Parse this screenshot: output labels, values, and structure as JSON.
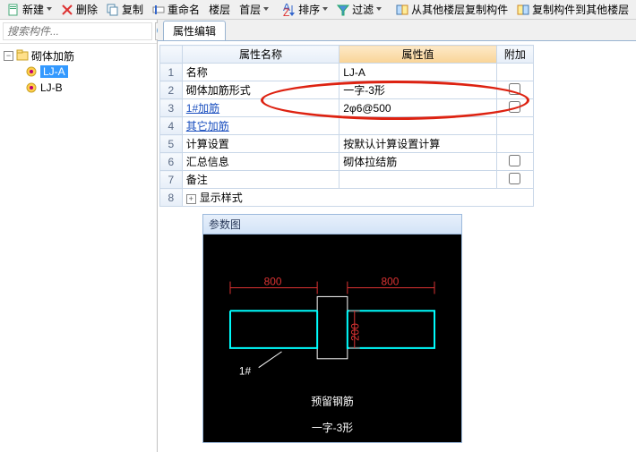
{
  "toolbar": {
    "new": "新建",
    "delete": "删除",
    "copy": "复制",
    "rename": "重命名",
    "layer": "楼层",
    "first": "首层",
    "sort": "排序",
    "filter": "过滤",
    "copy_from": "从其他楼层复制构件",
    "copy_to": "复制构件到其他楼层"
  },
  "search": {
    "placeholder": "搜索构件..."
  },
  "tree": {
    "root": "砌体加筋",
    "items": [
      "LJ-A",
      "LJ-B"
    ]
  },
  "tab": {
    "label": "属性编辑"
  },
  "table": {
    "headers": {
      "name": "属性名称",
      "value": "属性值",
      "extra": "附加"
    },
    "rows": [
      {
        "n": "1",
        "name": "名称",
        "value": "LJ-A",
        "chk": false
      },
      {
        "n": "2",
        "name": "砌体加筋形式",
        "value": "一字-3形",
        "chk": true
      },
      {
        "n": "3",
        "name": "1#加筋",
        "value": "2φ6@500",
        "link": true,
        "chk": true
      },
      {
        "n": "4",
        "name": "其它加筋",
        "value": "",
        "link": true,
        "chk": false
      },
      {
        "n": "5",
        "name": "计算设置",
        "value": "按默认计算设置计算",
        "chk": false
      },
      {
        "n": "6",
        "name": "汇总信息",
        "value": "砌体拉结筋",
        "chk": true
      },
      {
        "n": "7",
        "name": "备注",
        "value": "",
        "chk": true
      }
    ],
    "collapsed_row": {
      "n": "8",
      "label": "显示样式"
    }
  },
  "diagram": {
    "title": "参数图",
    "dim_left": "800",
    "dim_right": "800",
    "dim_h": "200",
    "tag": "1#",
    "caption1": "预留钢筋",
    "caption2": "一字-3形"
  }
}
